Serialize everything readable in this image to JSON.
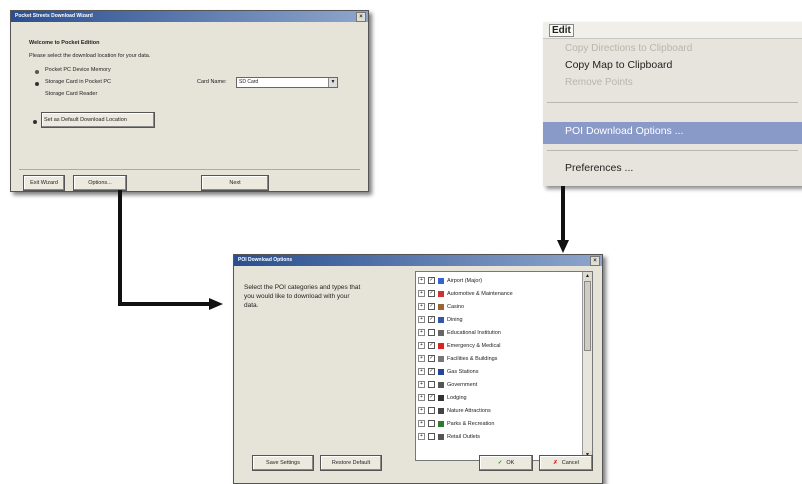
{
  "wizard": {
    "title": "Pocket Streets Download Wizard",
    "heading": "Welcome to Pocket Edition",
    "instruction": "Please select the download location for your data.",
    "options": [
      "Pocket PC Device Memory",
      "Storage Card in Pocket PC",
      "Storage Card Reader"
    ],
    "card_label": "Card Name:",
    "card_value": "SD Card",
    "default_location_button": "Set as Default Download Location",
    "exit_button": "Exit Wizard",
    "options_button": "Options...",
    "next_button": "Next"
  },
  "edit_menu": {
    "menu_title": "Edit",
    "items": [
      {
        "label": "Copy Directions to Clipboard",
        "enabled": false
      },
      {
        "label": "Copy Map to Clipboard",
        "enabled": true
      },
      {
        "label": "Remove Points",
        "enabled": false
      },
      {
        "label": "POI Download Options ...",
        "enabled": true,
        "highlighted": true
      },
      {
        "label": "Preferences ...",
        "enabled": true
      }
    ],
    "highlight_color": "#8a9ac8"
  },
  "poi_dialog": {
    "title": "POI Download Options",
    "instruction": "Select the POI categories and types that you would like to download with your data.",
    "categories": [
      {
        "label": "Airport (Major)",
        "checked": true,
        "icon_color": "#3366cc"
      },
      {
        "label": "Automotive & Maintenance",
        "checked": true,
        "icon_color": "#cc3333"
      },
      {
        "label": "Casino",
        "checked": true,
        "icon_color": "#996633"
      },
      {
        "label": "Dining",
        "checked": true,
        "icon_color": "#3355aa"
      },
      {
        "label": "Educational Institution",
        "checked": false,
        "icon_color": "#666666"
      },
      {
        "label": "Emergency & Medical",
        "checked": true,
        "icon_color": "#dd2222"
      },
      {
        "label": "Facilities & Buildings",
        "checked": true,
        "icon_color": "#777777"
      },
      {
        "label": "Gas Stations",
        "checked": true,
        "icon_color": "#224499"
      },
      {
        "label": "Government",
        "checked": false,
        "icon_color": "#555555"
      },
      {
        "label": "Lodging",
        "checked": true,
        "icon_color": "#333333"
      },
      {
        "label": "Nature Attractions",
        "checked": false,
        "icon_color": "#444444"
      },
      {
        "label": "Parks & Recreation",
        "checked": false,
        "icon_color": "#2c7a2c"
      },
      {
        "label": "Retail Outlets",
        "checked": false,
        "icon_color": "#555555"
      }
    ],
    "save_button": "Save Settings",
    "restore_button": "Restore Default",
    "ok_button": "OK",
    "cancel_button": "Cancel"
  }
}
